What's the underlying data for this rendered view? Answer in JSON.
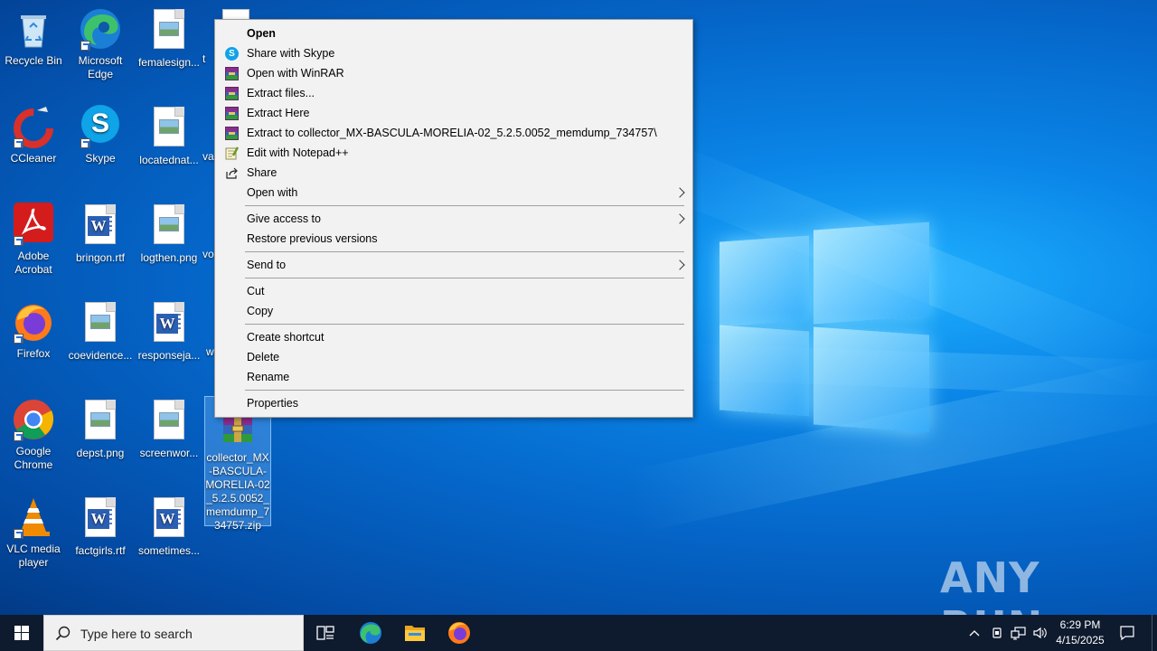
{
  "desktop": {
    "icons": [
      {
        "label": "Recycle Bin"
      },
      {
        "label": "Microsoft Edge"
      },
      {
        "label": "femalesign..."
      },
      {
        "label": "CCleaner"
      },
      {
        "label": "Skype"
      },
      {
        "label": "locatednat..."
      },
      {
        "label": "Adobe Acrobat"
      },
      {
        "label": "bringon.rtf"
      },
      {
        "label": "logthen.png"
      },
      {
        "label": "Firefox"
      },
      {
        "label": "coevidence..."
      },
      {
        "label": "responseja..."
      },
      {
        "label": "Google Chrome"
      },
      {
        "label": "depst.png"
      },
      {
        "label": "screenwor..."
      },
      {
        "label": "collector_MX-BASCULA-MORELIA-02_5.2.5.0052_memdump_734757.zip"
      },
      {
        "label": "VLC media player"
      },
      {
        "label": "factgirls.rtf"
      },
      {
        "label": "sometimes..."
      }
    ],
    "partial_labels": [
      "t",
      "va",
      "vo",
      "w"
    ],
    "watermark": "ANY RUN"
  },
  "context_menu": {
    "items": [
      {
        "label": "Open",
        "icon": "none"
      },
      {
        "label": "Share with Skype",
        "icon": "skype-icon"
      },
      {
        "label": "Open with WinRAR",
        "icon": "winrar-icon"
      },
      {
        "label": "Extract files...",
        "icon": "winrar-icon"
      },
      {
        "label": "Extract Here",
        "icon": "winrar-icon"
      },
      {
        "label": "Extract to collector_MX-BASCULA-MORELIA-02_5.2.5.0052_memdump_734757\\",
        "icon": "winrar-icon"
      },
      {
        "label": "Edit with Notepad++",
        "icon": "notepad-plus-plus-icon"
      },
      {
        "label": "Share",
        "icon": "share-icon"
      },
      {
        "label": "Open with",
        "icon": "none"
      },
      {
        "label": "Give access to",
        "icon": "none"
      },
      {
        "label": "Restore previous versions",
        "icon": "none"
      },
      {
        "label": "Send to",
        "icon": "none"
      },
      {
        "label": "Cut",
        "icon": "none"
      },
      {
        "label": "Copy",
        "icon": "none"
      },
      {
        "label": "Create shortcut",
        "icon": "none"
      },
      {
        "label": "Delete",
        "icon": "none"
      },
      {
        "label": "Rename",
        "icon": "none"
      },
      {
        "label": "Properties",
        "icon": "none"
      }
    ]
  },
  "taskbar": {
    "search_placeholder": "Type here to search",
    "time": "6:29 PM",
    "date": "4/15/2025"
  }
}
